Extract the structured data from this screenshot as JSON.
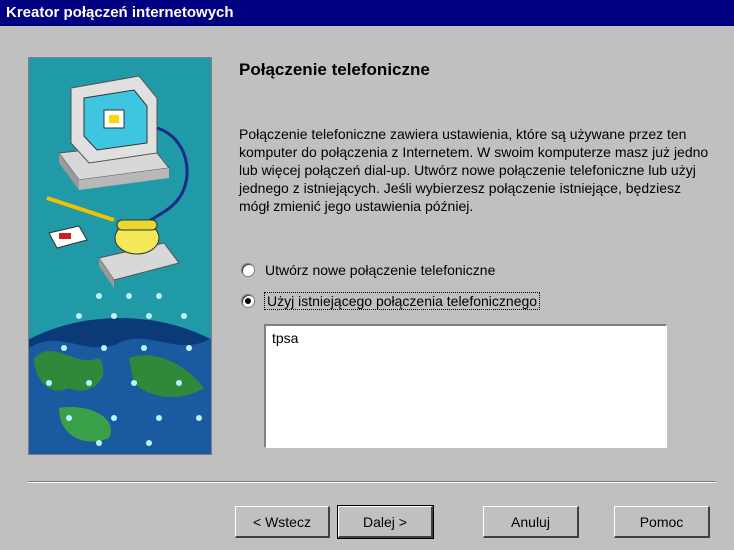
{
  "window": {
    "title": "Kreator połączeń internetowych"
  },
  "page": {
    "heading": "Połączenie telefoniczne",
    "description": "Połączenie telefoniczne zawiera ustawienia, które są używane przez ten komputer do połączenia z Internetem. W swoim komputerze masz już jedno lub więcej połączeń dial-up. Utwórz nowe połączenie telefoniczne lub użyj jednego z istniejących. Jeśli wybierzesz połączenie istniejące, będziesz mógł zmienić jego ustawienia później."
  },
  "options": [
    {
      "label": "Utwórz nowe połączenie telefoniczne",
      "checked": false
    },
    {
      "label": "Użyj istniejącego połączenia telefonicznego",
      "checked": true
    }
  ],
  "connections": [
    "tpsa"
  ],
  "buttons": {
    "back": "< Wstecz",
    "next": "Dalej >",
    "cancel": "Anuluj",
    "help": "Pomoc"
  },
  "colors": {
    "titlebar": "#000080",
    "panel": "#1f9aa6",
    "face": "#c0c0c0"
  }
}
